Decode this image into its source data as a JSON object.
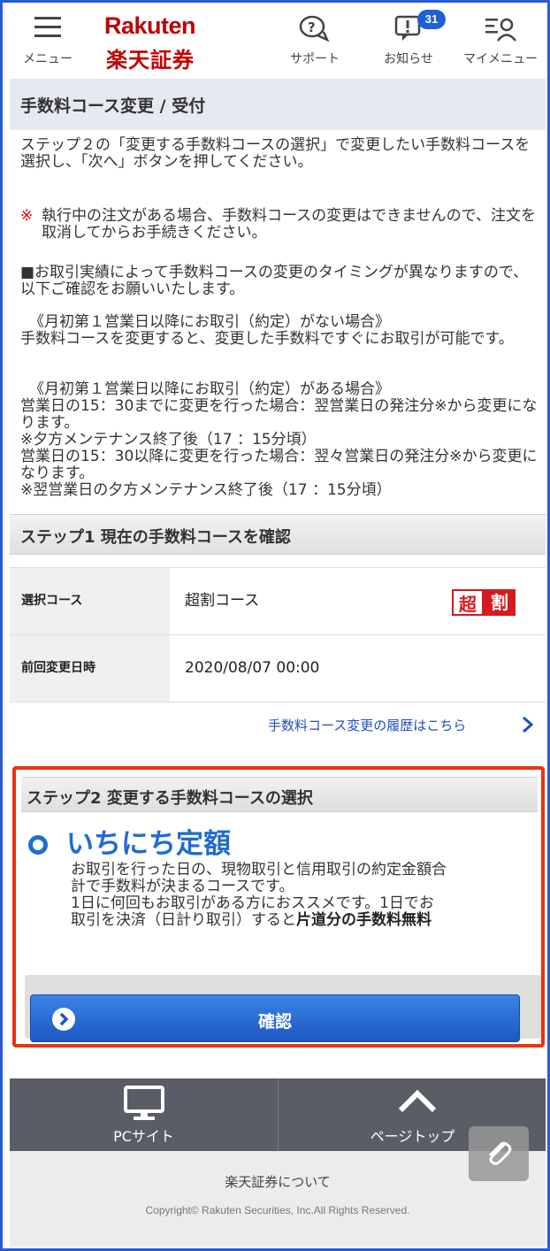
{
  "header": {
    "menu_label": "メニュー",
    "logo_en": "Rakuten",
    "logo_jp": "楽天証券",
    "support_label": "サポート",
    "news_label": "お知らせ",
    "news_count": "31",
    "mymenu_label": "マイメニュー"
  },
  "page": {
    "title": "手数料コース変更 / 受付"
  },
  "intro": {
    "p1": "ステップ２の「変更する手数料コースの選択」で変更したい手数料コースを選択し、「次へ」ボタンを押してください。",
    "p2_mark": "※",
    "p2": "執行中の注文がある場合、手数料コースの変更はできませんので、注文を取消してからお手続きください。",
    "p3": "■お取引実績によって手数料コースの変更のタイミングが異なりますので、以下ご確認をお願いいたします。",
    "p4_title": "《月初第１営業日以降にお取引（約定）がない場合》",
    "p4_body": "手数料コースを変更すると、変更した手数料ですぐにお取引が可能です。",
    "p5_title": "《月初第１営業日以降にお取引（約定）がある場合》",
    "p5_line1": "営業日の15：30までに変更を行った場合：翌営業日の発注分※から変更になります。",
    "p5_line2": "※夕方メンテナンス終了後（17 ：15分頃）",
    "p5_line3": "営業日の15：30以降に変更を行った場合：翌々営業日の発注分※から変更になります。",
    "p5_line4": "※翌営業日の夕方メンテナンス終了後（17 ：15分頃）"
  },
  "step1": {
    "title": "ステップ1 現在の手数料コースを確認",
    "rows": [
      {
        "key": "選択コース",
        "value": "超割コース"
      },
      {
        "key": "前回変更日時",
        "value": "2020/08/07 00:00"
      }
    ],
    "badge_1": "超",
    "badge_2": "割",
    "history_link": "手数料コース変更の履歴はこちら"
  },
  "step2": {
    "title": "ステップ2 変更する手数料コースの選択",
    "course_name": "いちにち定額",
    "desc_line1": "お取引を行った日の、現物取引と信用取引の約定金額合",
    "desc_line2": "計で手数料が決まるコースです。",
    "desc_line3": "1日に何回もお取引がある方におススメです。1日でお",
    "desc_line4_a": "取引を決済（日計り取引）すると",
    "desc_line4_b": "片道分の手数料無料",
    "confirm_label": "確認"
  },
  "footer": {
    "pc_label": "PCサイト",
    "top_label": "ページトップ",
    "about": "楽天証券について",
    "copyright": "Copyright© Rakuten Securities, Inc.All Rights Reserved."
  },
  "colors": {
    "brand": "#bf0000",
    "accent": "#1f6cd2",
    "highlight_border": "#e8340f",
    "frame": "#2a5bd7"
  }
}
